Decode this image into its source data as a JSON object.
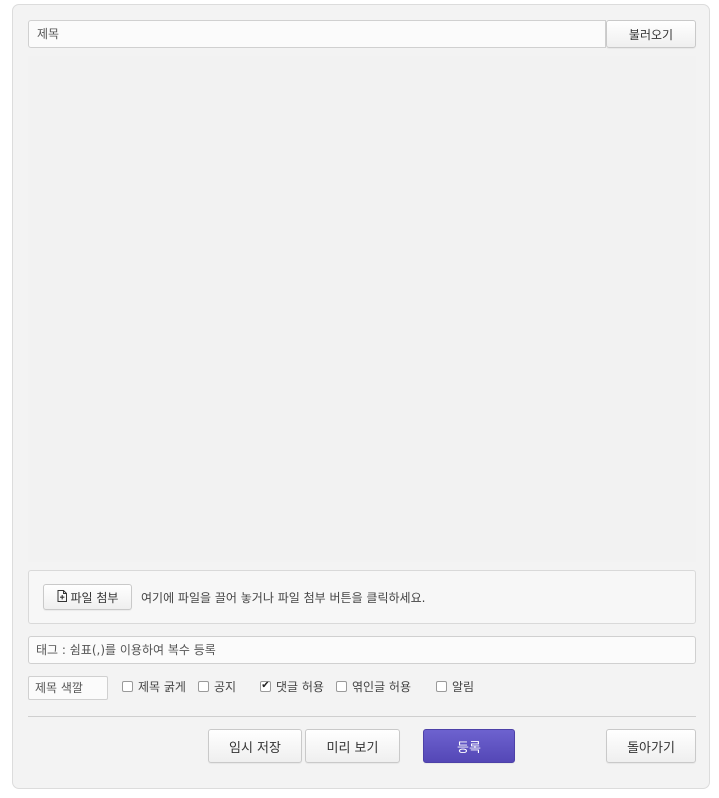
{
  "header": {
    "title_placeholder": "제목",
    "load_label": "불러오기"
  },
  "attachments": {
    "attach_label": "파일 첨부",
    "attach_icon": "file-plus-icon",
    "drop_hint": "여기에 파일을 끌어 놓거나 파일 첨부 버튼을 클릭하세요."
  },
  "tags": {
    "placeholder": "태그 : 쉼표(,)를 이용하여 복수 등록"
  },
  "options": {
    "color_placeholder": "제목 색깔",
    "items": [
      {
        "label": "제목 굵게",
        "checked": false
      },
      {
        "label": "공지",
        "checked": false
      },
      {
        "label": "댓글 허용",
        "checked": true
      },
      {
        "label": "엮인글 허용",
        "checked": false
      },
      {
        "label": "알림",
        "checked": false
      }
    ]
  },
  "actions": {
    "temp_save": "임시 저장",
    "preview": "미리 보기",
    "submit": "등록",
    "back": "돌아가기"
  },
  "colors": {
    "submit_bg": "#5a4dbf",
    "panel_bg": "#f3f3f3"
  }
}
